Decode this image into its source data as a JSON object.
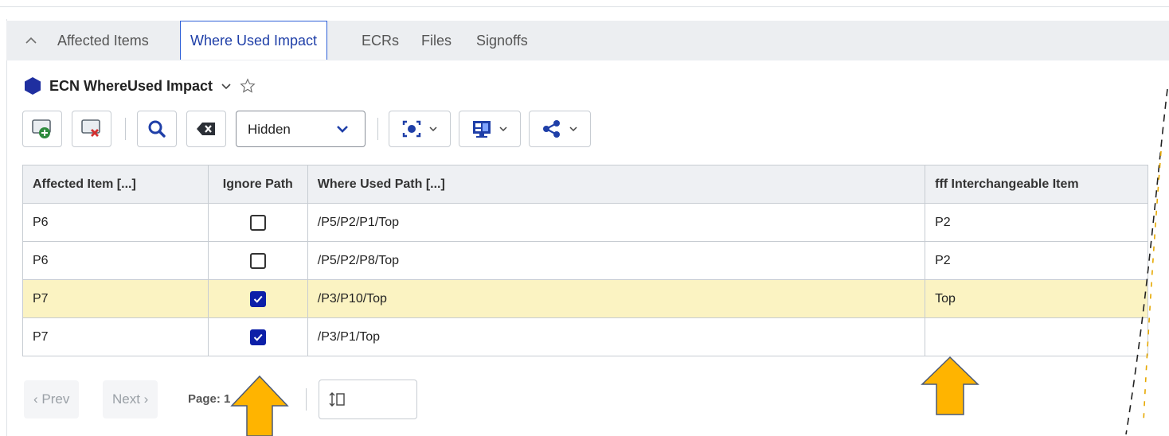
{
  "tabs": [
    "Affected Items",
    "Where Used Impact",
    "ECRs",
    "Files",
    "Signoffs"
  ],
  "active_tab": "Where Used Impact",
  "view": {
    "title": "ECN WhereUsed Impact"
  },
  "toolbar": {
    "filter_value": "Hidden"
  },
  "table": {
    "headers": [
      "Affected Item [...]",
      "Ignore Path",
      "Where Used Path [...]",
      "fff Interchangeable Item"
    ],
    "rows": [
      {
        "item": "P6",
        "ignore": false,
        "path": "/P5/P2/P1/Top",
        "interchangeable": "P2"
      },
      {
        "item": "P6",
        "ignore": false,
        "path": "/P5/P2/P8/Top",
        "interchangeable": "P2"
      },
      {
        "item": "P7",
        "ignore": true,
        "path": "/P3/P10/Top",
        "interchangeable": "Top"
      },
      {
        "item": "P7",
        "ignore": true,
        "path": "/P3/P1/Top",
        "interchangeable": ""
      }
    ]
  },
  "pager": {
    "prev": "‹ Prev",
    "next": "Next ›",
    "page_label": "Page: 1"
  },
  "colors": {
    "accent": "#1f3fa8",
    "selected_row": "#fbf3c2",
    "arrow": "#ffb400",
    "checkbox_on": "#0c1fa8"
  }
}
